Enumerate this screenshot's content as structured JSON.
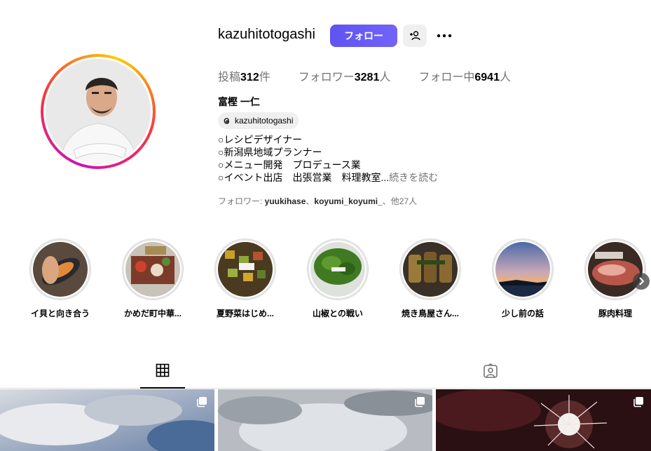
{
  "profile": {
    "username": "kazuhitotogashi",
    "follow_label": "フォロー",
    "stats": {
      "posts_prefix": "投稿",
      "posts_count": "312",
      "posts_suffix": "件",
      "followers_prefix": "フォロワー",
      "followers_count": "3281",
      "followers_suffix": "人",
      "following_prefix": "フォロー中",
      "following_count": "6941",
      "following_suffix": "人"
    },
    "full_name": "富樫 一仁",
    "threads_handle": "kazuhitotogashi",
    "bio_lines": [
      "○レシピデザイナー",
      "○新潟県地域プランナー",
      "○メニュー開発　プロデュース業",
      "○イベント出店　出張営業　料理教室..."
    ],
    "bio_more": "続きを読む",
    "followed_by_prefix": "フォロワー: ",
    "followed_by_user1": "yuukihase",
    "followed_by_sep": "、",
    "followed_by_user2": "koyumi_koyumi_",
    "followed_by_suffix": "、他27人"
  },
  "highlights": [
    {
      "label": "イ貝と向き合う"
    },
    {
      "label": "かめだ町中華..."
    },
    {
      "label": "夏野菜はじめ..."
    },
    {
      "label": "山椒との戦い"
    },
    {
      "label": "焼き鳥屋さん..."
    },
    {
      "label": "少し前の話"
    },
    {
      "label": "豚肉料理"
    }
  ],
  "tabs": [
    {
      "icon": "grid-icon",
      "active": true
    },
    {
      "icon": "tagged-icon",
      "active": false
    }
  ],
  "icons": {
    "add_user": "add-user-icon",
    "more": "more-dots-icon",
    "threads": "threads-icon",
    "next": "chevron-right-icon",
    "multi": "multiple-posts-icon"
  },
  "colors": {
    "follow_button": "#5f53f2",
    "muted_text": "#737373",
    "chip_bg": "#efefef"
  }
}
